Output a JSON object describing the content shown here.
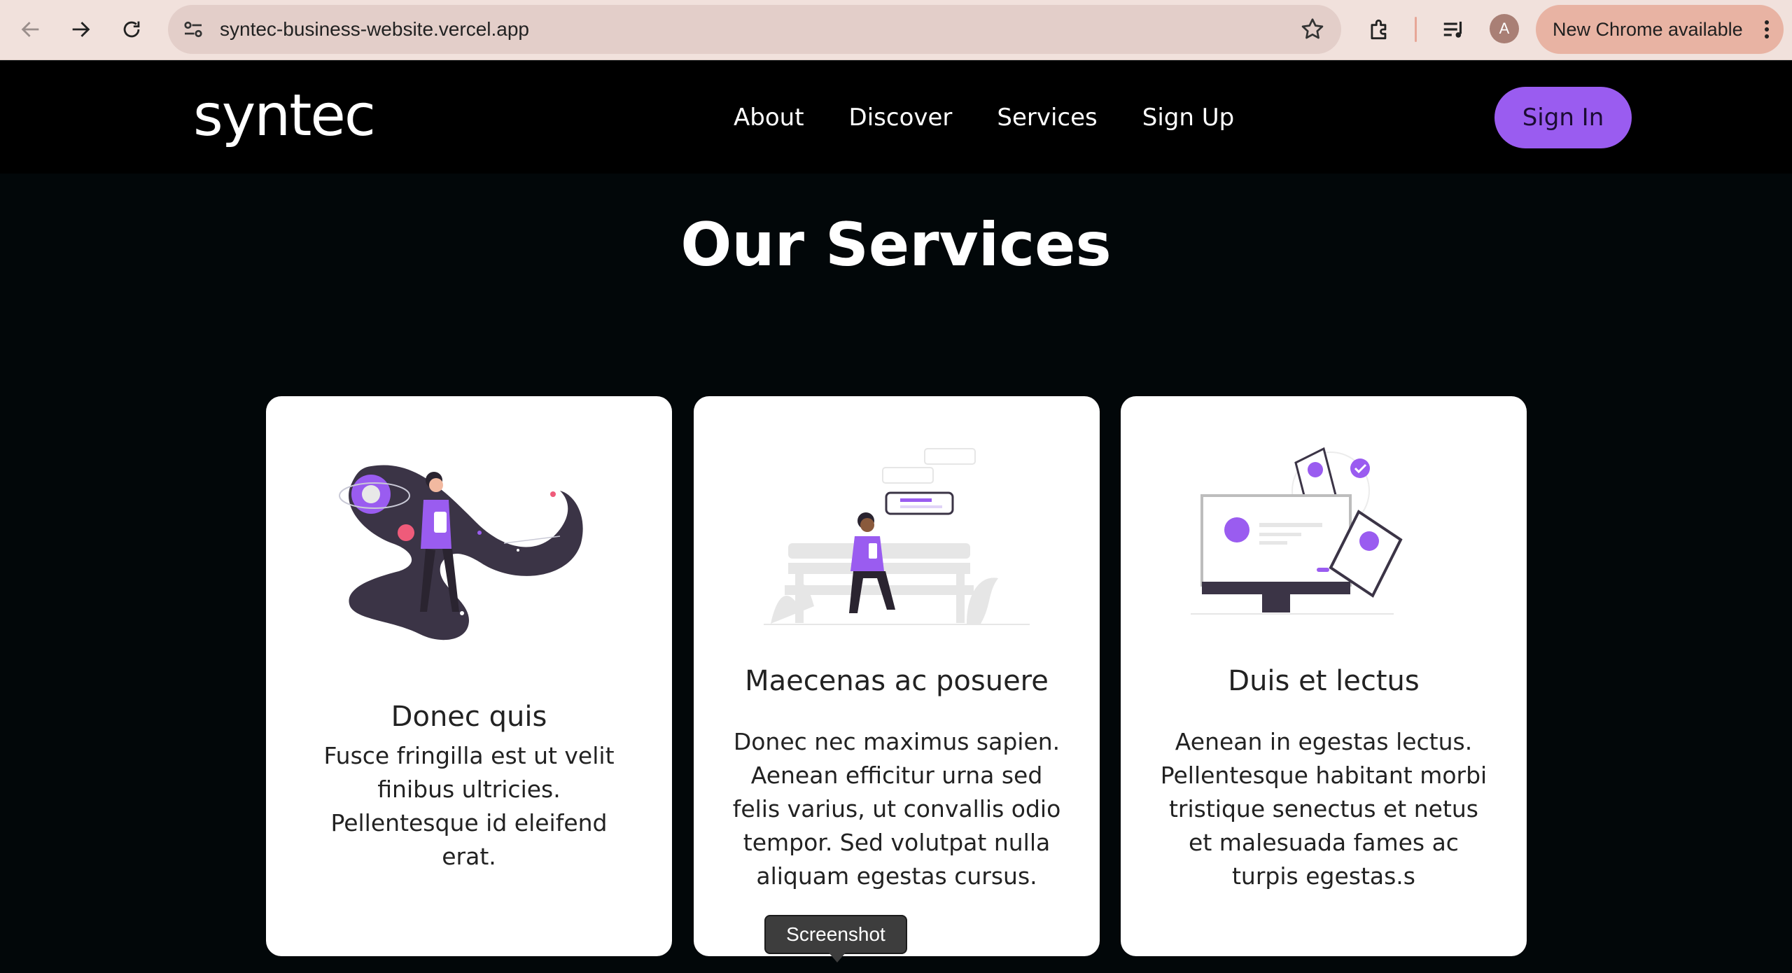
{
  "browser": {
    "url": "syntec-business-website.vercel.app",
    "avatar_letter": "A",
    "update_label": "New Chrome available",
    "icons": [
      "back-icon",
      "forward-icon",
      "reload-icon",
      "site-settings-icon",
      "bookmark-star-icon",
      "extensions-icon",
      "media-control-icon",
      "kebab-menu-icon"
    ]
  },
  "site": {
    "logo": "syntec",
    "nav": [
      "About",
      "Discover",
      "Services",
      "Sign Up"
    ],
    "signin_label": "Sign In",
    "accent": "#9a5cf0"
  },
  "services": {
    "title": "Our Services",
    "cards": [
      {
        "title": "Donec quis",
        "text": "Fusce fringilla est ut velit finibus ultricies. Pellentesque id eleifend erat."
      },
      {
        "title": "Maecenas ac posuere",
        "text": "Donec nec maximus sapien. Aenean efficitur urna sed felis varius, ut convallis odio tempor. Sed volutpat nulla aliquam egestas cursus."
      },
      {
        "title": "Duis et lectus",
        "text": "Aenean in egestas lectus. Pellentesque habitant morbi tristique senectus et netus et malesuada fames ac turpis egestas.s"
      }
    ]
  },
  "tooltip": "Screenshot"
}
